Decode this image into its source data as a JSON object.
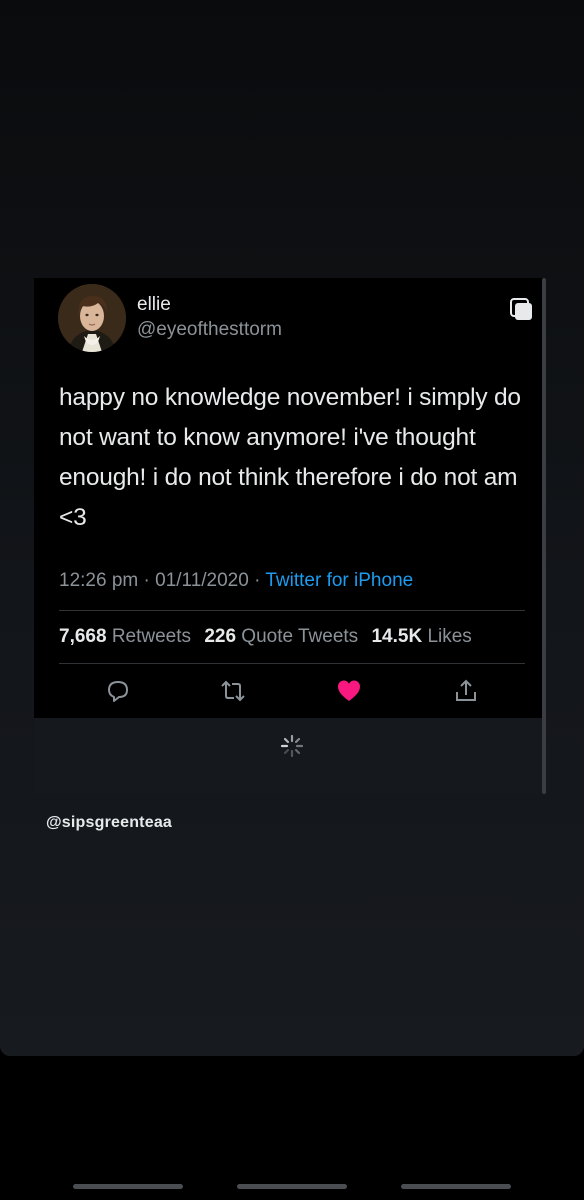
{
  "tweet": {
    "display_name": "ellie",
    "handle": "@eyeofthesttorm",
    "text": "happy no knowledge november! i simply do not want to know anymore! i've thought enough! i do not think therefore i do not am <3",
    "time": "12:26 pm",
    "date": "01/11/2020",
    "source": "Twitter for iPhone",
    "separator": " · ",
    "retweets_count": "7,668",
    "retweets_label": "Retweets",
    "quote_count": "226",
    "quote_label": "Quote Tweets",
    "likes_count": "14.5K",
    "likes_label": "Likes",
    "liked": true
  },
  "actions": [
    {
      "icon": "reply-icon"
    },
    {
      "icon": "retweet-icon"
    },
    {
      "icon": "heart-icon"
    },
    {
      "icon": "share-icon"
    }
  ],
  "loading": {
    "icon": "spinner-icon"
  },
  "credit": "@sipsgreenteaa",
  "colors": {
    "background": "#000000",
    "text": "#e7e9ea",
    "muted": "#8b9298",
    "link": "#1d9bf0",
    "like": "#f91880"
  }
}
